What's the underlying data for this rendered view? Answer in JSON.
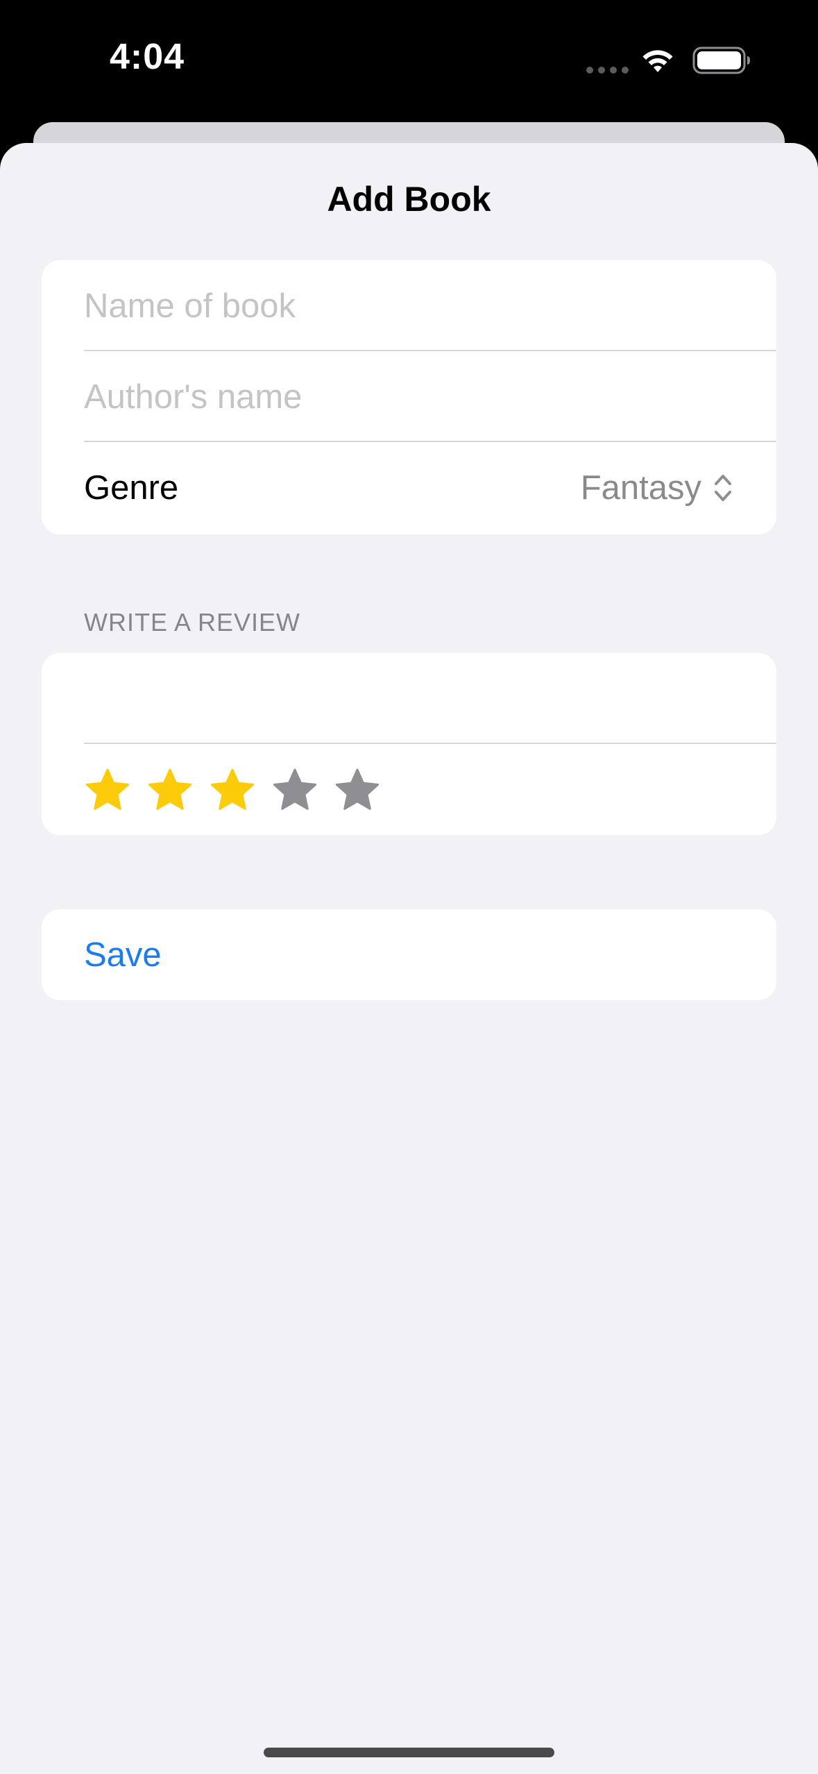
{
  "status_bar": {
    "time": "4:04",
    "icons": [
      "signal-dots-icon",
      "wifi-icon",
      "battery-icon"
    ]
  },
  "sheet": {
    "title": "Add Book"
  },
  "form": {
    "book_name": {
      "value": "",
      "placeholder": "Name of book"
    },
    "author_name": {
      "value": "",
      "placeholder": "Author's name"
    },
    "genre": {
      "label": "Genre",
      "selected": "Fantasy"
    },
    "review": {
      "header": "WRITE A REVIEW",
      "text": "",
      "rating": 3,
      "max_rating": 5
    },
    "save_label": "Save"
  },
  "colors": {
    "star_filled": "#fccc0a",
    "star_empty": "#8e8e93",
    "accent": "#1a7cf0",
    "background": "#f1f1f6"
  }
}
